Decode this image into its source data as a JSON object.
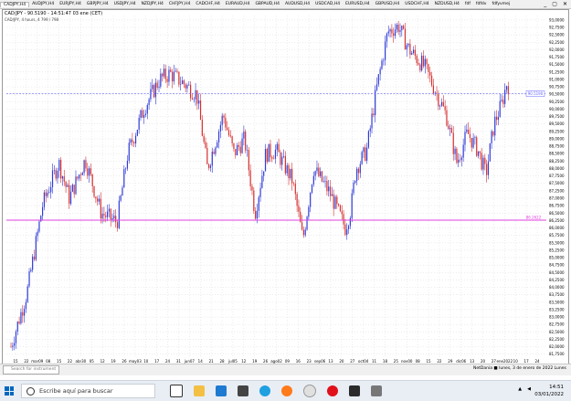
{
  "tabs": [
    "CADJPY,H4",
    "AUDJPY,H4",
    "EURJPY,H4",
    "GBPJPY,H4",
    "USDJPY,H4",
    "NZDJPY,H4",
    "CHFJPY,H4",
    "CADCHF,H4",
    "EURAUD,H4",
    "GBPAUD,H4",
    "AUDUSD,H4",
    "USDCAD,H4",
    "EURUSD,H4",
    "GBPUSD,H4",
    "USDCHF,H4",
    "NZDUSD,H4",
    "fdf",
    "fdfdv",
    "fdfyvmej"
  ],
  "chart": {
    "symbol_label": "CAD/JPY - 90.5190 - 14:51:47 03 ene (CET)",
    "sub_label": "CAD/JPY, 4 hours, 4 799 / 798",
    "colors": {
      "bull": "#2f3bd6",
      "bear": "#d62f2f",
      "grid": "#d0d0d0",
      "dotted_line": "#6464ff",
      "magenta": "#e040e0"
    },
    "price_axis_labels": [
      "93,0000",
      "92,7500",
      "92,5000",
      "92,2500",
      "92,0000",
      "91,7500",
      "91,5000",
      "91,2500",
      "91,0000",
      "90,7500",
      "90,5000",
      "90,2500",
      "90,0000",
      "89,7500",
      "89,5000",
      "89,2500",
      "89,0000",
      "88,7500",
      "88,5000",
      "88,2500",
      "88,0000",
      "87,7500",
      "87,5000",
      "87,2500",
      "87,0000",
      "86,7500",
      "86,5000",
      "86,2500",
      "86,0000",
      "85,7500",
      "85,5000",
      "85,2500",
      "85,0000",
      "84,7500",
      "84,5000",
      "84,2500",
      "84,0000",
      "83,7500",
      "83,5000",
      "83,2500",
      "83,0000",
      "82,7500",
      "82,5000",
      "82,2500",
      "82,0000",
      "81,7500"
    ],
    "price_min": 81.65,
    "price_max": 93.15,
    "current_price": "90.5190",
    "current_price_value": 90.519,
    "magenta_level_label": "86.2622",
    "magenta_level_value": 86.2622,
    "date_axis_labels": [
      "15",
      "22",
      "mar09",
      "08",
      "15",
      "22",
      "abr30",
      "05",
      "12",
      "19",
      "26",
      "may03",
      "10",
      "17",
      "24",
      "31",
      "jun07",
      "14",
      "21",
      "28",
      "jul05",
      "12",
      "19",
      "26",
      "ago02",
      "09",
      "16",
      "23",
      "sep06",
      "13",
      "20",
      "27",
      "oct04",
      "11",
      "18",
      "25",
      "nov00",
      "08",
      "15",
      "22",
      "29",
      "dic06",
      "13",
      "20",
      "27",
      "ene2022",
      "10",
      "17",
      "24"
    ]
  },
  "bottom": {
    "search_placeholder": "Search for instrument",
    "status": "NetDania ■ lunes, 3 de enero de 2022  Lunes"
  },
  "taskbar": {
    "search_text": "Escribe aquí para buscar",
    "time": "14:51",
    "date": "03/01/2022"
  },
  "icons": {
    "start": "windows-logo-icon",
    "search": "search-icon"
  }
}
